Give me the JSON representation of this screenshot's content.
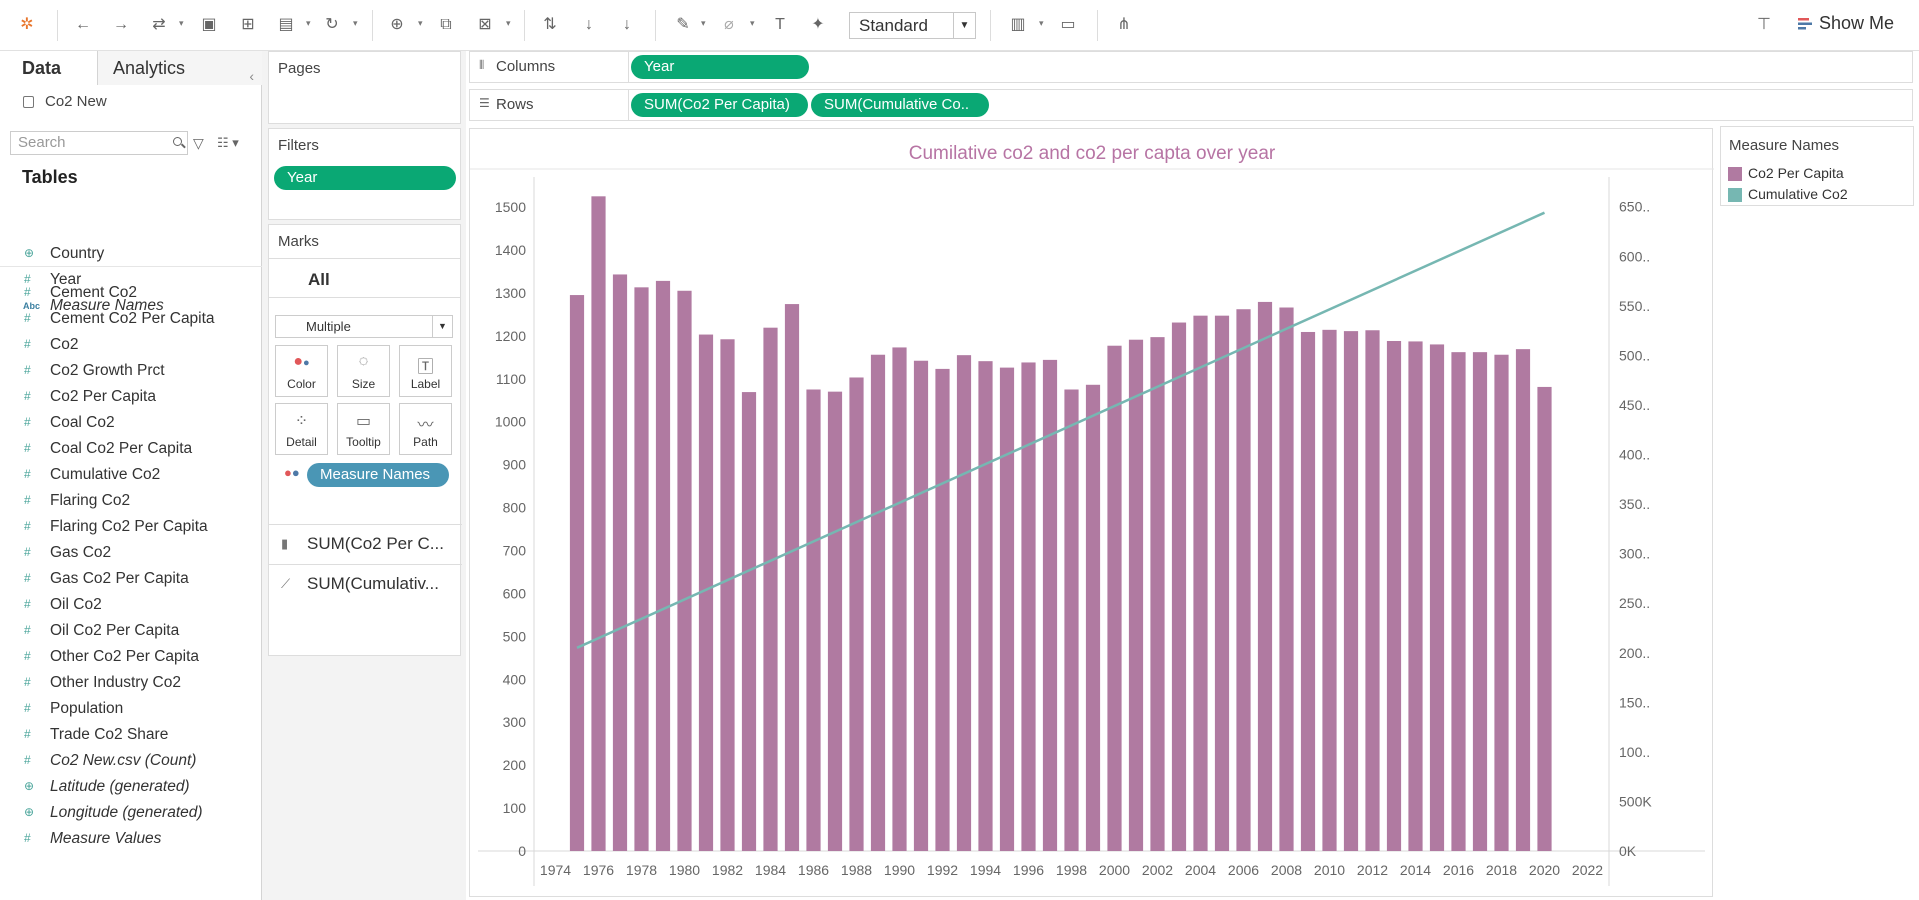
{
  "toolbar": {
    "fit_mode": "Standard",
    "show_me_label": "Show Me"
  },
  "datapane": {
    "tab_data": "Data",
    "tab_analytics": "Analytics",
    "datasource": "Co2 New",
    "search_placeholder": "Search",
    "tables_header": "Tables",
    "fields": [
      {
        "label": "Country",
        "icon": "globe-icon",
        "italic": false
      },
      {
        "label": "Year",
        "icon": "dimension-icon",
        "italic": false
      },
      {
        "label": "Measure Names",
        "icon": "abc-icon",
        "italic": true
      },
      {
        "label": "Cement Co2",
        "icon": "measure-icon",
        "italic": false
      },
      {
        "label": "Cement Co2 Per Capita",
        "icon": "measure-icon",
        "italic": false
      },
      {
        "label": "Co2",
        "icon": "measure-icon",
        "italic": false
      },
      {
        "label": "Co2 Growth Prct",
        "icon": "measure-icon",
        "italic": false
      },
      {
        "label": "Co2 Per Capita",
        "icon": "measure-icon",
        "italic": false
      },
      {
        "label": "Coal Co2",
        "icon": "measure-icon",
        "italic": false
      },
      {
        "label": "Coal Co2 Per Capita",
        "icon": "measure-icon",
        "italic": false
      },
      {
        "label": "Cumulative Co2",
        "icon": "measure-icon",
        "italic": false
      },
      {
        "label": "Flaring Co2",
        "icon": "measure-icon",
        "italic": false
      },
      {
        "label": "Flaring Co2 Per Capita",
        "icon": "measure-icon",
        "italic": false
      },
      {
        "label": "Gas Co2",
        "icon": "measure-icon",
        "italic": false
      },
      {
        "label": "Gas Co2 Per Capita",
        "icon": "measure-icon",
        "italic": false
      },
      {
        "label": "Oil Co2",
        "icon": "measure-icon",
        "italic": false
      },
      {
        "label": "Oil Co2 Per Capita",
        "icon": "measure-icon",
        "italic": false
      },
      {
        "label": "Other Co2 Per Capita",
        "icon": "measure-icon",
        "italic": false
      },
      {
        "label": "Other Industry Co2",
        "icon": "measure-icon",
        "italic": false
      },
      {
        "label": "Population",
        "icon": "measure-icon",
        "italic": false
      },
      {
        "label": "Trade Co2 Share",
        "icon": "measure-icon",
        "italic": false
      },
      {
        "label": "Co2 New.csv (Count)",
        "icon": "measure-icon",
        "italic": true
      },
      {
        "label": "Latitude (generated)",
        "icon": "globe-icon",
        "italic": true
      },
      {
        "label": "Longitude (generated)",
        "icon": "globe-icon",
        "italic": true
      },
      {
        "label": "Measure Values",
        "icon": "measure-icon",
        "italic": true
      }
    ]
  },
  "shelves": {
    "pages_label": "Pages",
    "filters_label": "Filters",
    "filter_pill": "Year",
    "columns_label": "Columns",
    "columns_pill": "Year",
    "rows_label": "Rows",
    "rows_pill_1": "SUM(Co2 Per Capita)",
    "rows_pill_2": "SUM(Cumulative Co..",
    "marks_label": "Marks",
    "marks_all": "All",
    "marks_type": "Multiple",
    "mark_buttons": [
      "Color",
      "Size",
      "Label",
      "Detail",
      "Tooltip",
      "Path"
    ],
    "marks_pill": "Measure Names",
    "marks_row_1": "SUM(Co2 Per C...",
    "marks_row_2": "SUM(Cumulativ..."
  },
  "legend": {
    "title": "Measure Names",
    "items": [
      {
        "label": "Co2 Per Capita",
        "color": "#b07aa1"
      },
      {
        "label": "Cumulative Co2",
        "color": "#76b7b2"
      }
    ]
  },
  "chart_data": {
    "type": "bar",
    "title": "Cumilative co2 and co2 per capta over year",
    "x_tick_labels": [
      "1974",
      "1976",
      "1978",
      "1980",
      "1982",
      "1984",
      "1986",
      "1988",
      "1990",
      "1992",
      "1994",
      "1996",
      "1998",
      "2000",
      "2002",
      "2004",
      "2006",
      "2008",
      "2010",
      "2012",
      "2014",
      "2016",
      "2018",
      "2020",
      "2022"
    ],
    "x_range": [
      1973,
      2023
    ],
    "years": [
      1975,
      1976,
      1977,
      1978,
      1979,
      1980,
      1981,
      1982,
      1983,
      1984,
      1985,
      1986,
      1987,
      1988,
      1989,
      1990,
      1991,
      1992,
      1993,
      1994,
      1995,
      1996,
      1997,
      1998,
      1999,
      2000,
      2001,
      2002,
      2003,
      2004,
      2005,
      2006,
      2007,
      2008,
      2009,
      2010,
      2011,
      2012,
      2013,
      2014,
      2015,
      2016,
      2017,
      2018,
      2019,
      2020
    ],
    "series": [
      {
        "name": "Co2 Per Capita",
        "color": "#b07aa1",
        "mark": "bar",
        "axis": "left",
        "values": [
          1295,
          1525,
          1343,
          1313,
          1328,
          1305,
          1203,
          1192,
          1069,
          1219,
          1274,
          1075,
          1070,
          1103,
          1156,
          1173,
          1142,
          1123,
          1155,
          1141,
          1126,
          1138,
          1144,
          1075,
          1086,
          1177,
          1191,
          1197,
          1231,
          1247,
          1247,
          1262,
          1279,
          1266,
          1209,
          1214,
          1211,
          1213,
          1188,
          1187,
          1180,
          1162,
          1162,
          1156,
          1169,
          1081
        ]
      },
      {
        "name": "Cumulative Co2",
        "color": "#76b7b2",
        "mark": "line",
        "axis": "right",
        "start": {
          "year": 1975,
          "value": 2050000
        },
        "end": {
          "year": 2020,
          "value": 6440000
        }
      }
    ],
    "y_left": {
      "ticks": [
        0,
        100,
        200,
        300,
        400,
        500,
        600,
        700,
        800,
        900,
        1000,
        1100,
        1200,
        1300,
        1400,
        1500
      ],
      "range": [
        0,
        1570
      ]
    },
    "y_right": {
      "ticks": [
        0,
        500000,
        1000000,
        1500000,
        2000000,
        2500000,
        3000000,
        3500000,
        4000000,
        4500000,
        5000000,
        5500000,
        6000000,
        6500000
      ],
      "tick_labels": [
        "0K",
        "500K",
        "100..",
        "150..",
        "200..",
        "250..",
        "300..",
        "350..",
        "400..",
        "450..",
        "500..",
        "550..",
        "600..",
        "650.."
      ],
      "range": [
        0,
        6800000
      ]
    }
  }
}
